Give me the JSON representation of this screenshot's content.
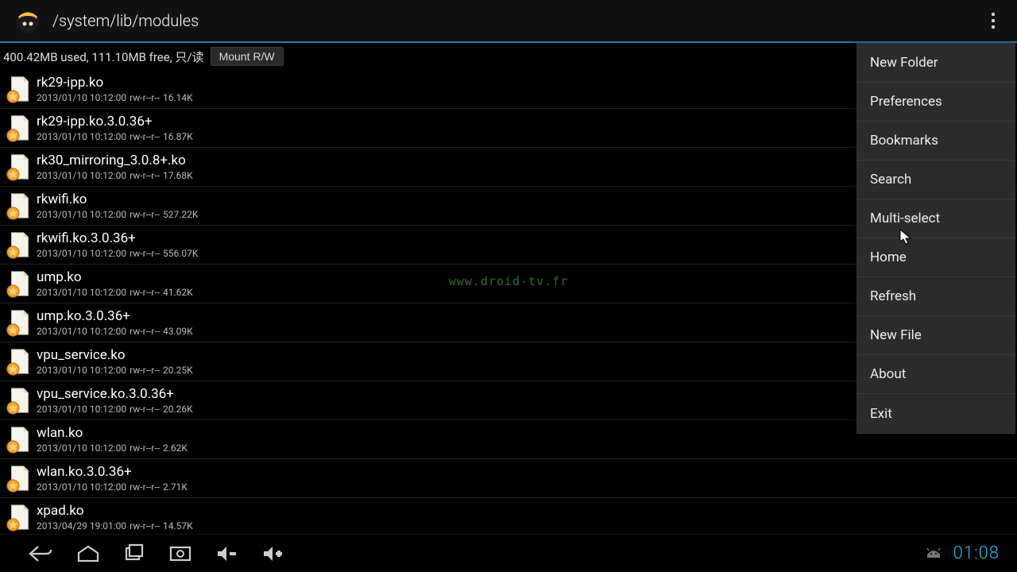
{
  "header": {
    "path": "/system/lib/modules"
  },
  "status": {
    "usage_text": "400.42MB used, 111.10MB free, 只/读",
    "mount_button_label": "Mount R/W"
  },
  "watermark": "www.droid-tv.fr",
  "files": [
    {
      "name": "rk29-ipp.ko",
      "date": "2013/01/10 10:12:00",
      "perms": "rw-r--r--",
      "size": "16.14K"
    },
    {
      "name": "rk29-ipp.ko.3.0.36+",
      "date": "2013/01/10 10:12:00",
      "perms": "rw-r--r--",
      "size": "16.87K"
    },
    {
      "name": "rk30_mirroring_3.0.8+.ko",
      "date": "2013/01/10 10:12:00",
      "perms": "rw-r--r--",
      "size": "17.68K"
    },
    {
      "name": "rkwifi.ko",
      "date": "2013/01/10 10:12:00",
      "perms": "rw-r--r--",
      "size": "527.22K"
    },
    {
      "name": "rkwifi.ko.3.0.36+",
      "date": "2013/01/10 10:12:00",
      "perms": "rw-r--r--",
      "size": "556.07K"
    },
    {
      "name": "ump.ko",
      "date": "2013/01/10 10:12:00",
      "perms": "rw-r--r--",
      "size": "41.62K"
    },
    {
      "name": "ump.ko.3.0.36+",
      "date": "2013/01/10 10:12:00",
      "perms": "rw-r--r--",
      "size": "43.09K"
    },
    {
      "name": "vpu_service.ko",
      "date": "2013/01/10 10:12:00",
      "perms": "rw-r--r--",
      "size": "20.25K"
    },
    {
      "name": "vpu_service.ko.3.0.36+",
      "date": "2013/01/10 10:12:00",
      "perms": "rw-r--r--",
      "size": "20.26K"
    },
    {
      "name": "wlan.ko",
      "date": "2013/01/10 10:12:00",
      "perms": "rw-r--r--",
      "size": "2.62K"
    },
    {
      "name": "wlan.ko.3.0.36+",
      "date": "2013/01/10 10:12:00",
      "perms": "rw-r--r--",
      "size": "2.71K"
    },
    {
      "name": "xpad.ko",
      "date": "2013/04/29 19:01:00",
      "perms": "rw-r--r--",
      "size": "14.57K"
    }
  ],
  "menu": {
    "items": [
      "New Folder",
      "Preferences",
      "Bookmarks",
      "Search",
      "Multi-select",
      "Home",
      "Refresh",
      "New File",
      "About",
      "Exit"
    ]
  },
  "navbar": {
    "clock": "01:08"
  }
}
